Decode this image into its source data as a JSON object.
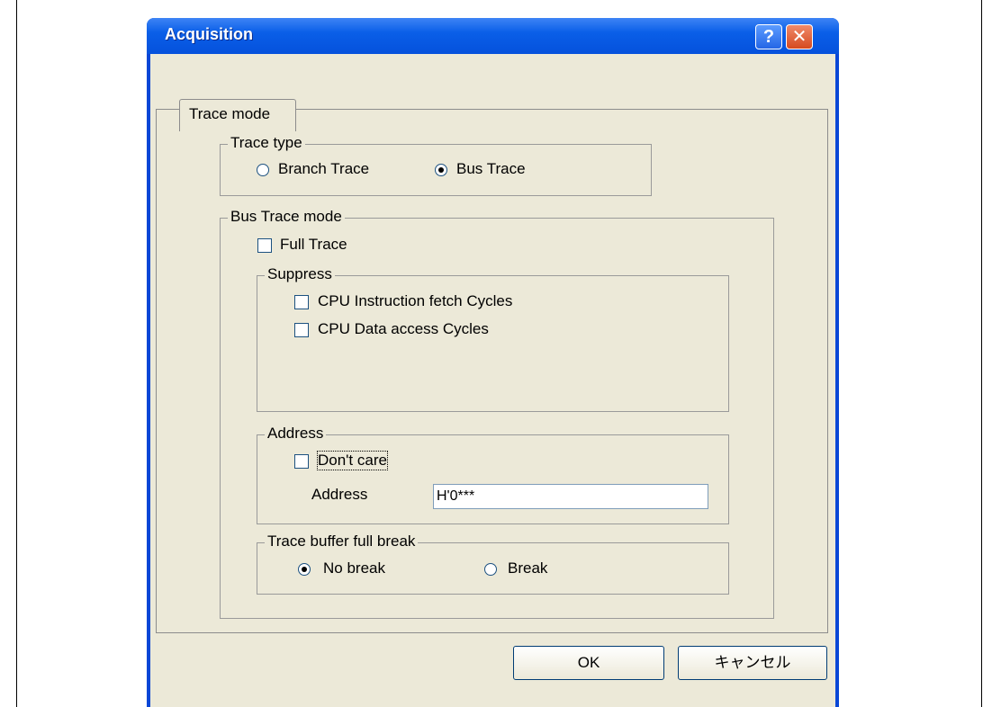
{
  "dialog": {
    "title": "Acquisition",
    "help_label": "?",
    "close_label": "✕"
  },
  "tabs": [
    {
      "label": "Trace mode",
      "selected": true
    }
  ],
  "trace_type": {
    "legend": "Trace type",
    "options": [
      {
        "label": "Branch Trace",
        "selected": false
      },
      {
        "label": "Bus Trace",
        "selected": true
      }
    ]
  },
  "bus_trace_mode": {
    "legend": "Bus Trace mode",
    "full_trace": {
      "label": "Full Trace",
      "checked": false
    },
    "suppress": {
      "legend": "Suppress",
      "items": [
        {
          "label": "CPU Instruction fetch Cycles",
          "checked": false
        },
        {
          "label": "CPU Data access Cycles",
          "checked": false
        }
      ]
    },
    "address": {
      "legend": "Address",
      "dont_care": {
        "label": "Don't care",
        "checked": false
      },
      "field_label": "Address",
      "field_value": "H'0***"
    },
    "trace_buffer_full_break": {
      "legend": "Trace buffer full break",
      "options": [
        {
          "label": "No break",
          "selected": true
        },
        {
          "label": "Break",
          "selected": false
        }
      ]
    }
  },
  "buttons": {
    "ok": "OK",
    "cancel": "キャンセル"
  },
  "colors": {
    "titlebar": "#0a5fe8",
    "dialog_bg": "#ece9d8",
    "close_button": "#d64a20"
  }
}
